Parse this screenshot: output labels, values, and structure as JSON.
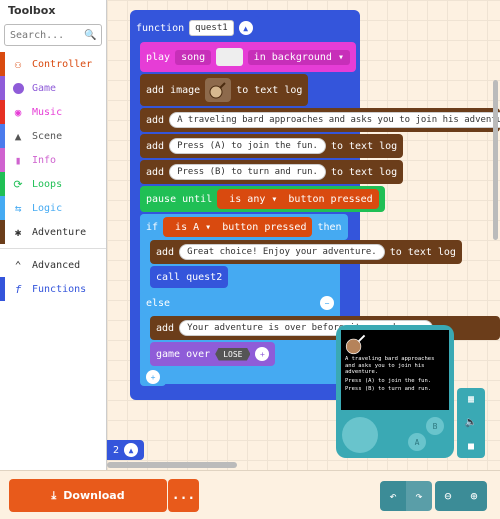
{
  "toolbox": {
    "title": "Toolbox",
    "search_placeholder": "Search...",
    "items": [
      {
        "label": "Controller",
        "color": "#d94a0f",
        "icon": "gamepad-icon"
      },
      {
        "label": "Game",
        "color": "#8f5cd8",
        "icon": "circle-icon"
      },
      {
        "label": "Music",
        "color": "#e63022",
        "icon": "headphones-icon"
      },
      {
        "label": "Scene",
        "color": "#4b7bec",
        "icon": "tree-icon"
      },
      {
        "label": "Info",
        "color": "#cf63cf",
        "icon": "card-icon"
      },
      {
        "label": "Loops",
        "color": "#20bf55",
        "icon": "loop-icon"
      },
      {
        "label": "Logic",
        "color": "#45aaf2",
        "icon": "shuffle-icon"
      },
      {
        "label": "Adventure",
        "color": "#6b3d1a",
        "icon": "compass-icon"
      },
      {
        "label": "Advanced",
        "color": "#333333",
        "icon": "chevron-up-icon"
      },
      {
        "label": "Functions",
        "color": "#3455db",
        "icon": "function-icon"
      }
    ]
  },
  "blocks": {
    "function_label": "function",
    "function_name": "quest1",
    "play": "play",
    "song": "song",
    "in_background": "in background",
    "add_image": "add image",
    "to_text_log": "to text log",
    "add": "add",
    "text1": "A traveling bard approaches and asks you to join his adventure.",
    "text2": "Press (A) to join the fun.",
    "text3": "Press (B) to turn and run.",
    "pause_until": "pause until",
    "is_any": "is any",
    "button_pressed": "button pressed",
    "if": "if",
    "is_A": "is A",
    "then": "then",
    "text4": "Great choice! Enjoy your adventure.",
    "call_quest2": "call quest2",
    "else": "else",
    "text5": "Your adventure is over before it even began.",
    "game_over": "game over",
    "lose": "LOSE",
    "side_num": "2"
  },
  "simulator": {
    "line1": "A traveling bard approaches and asks you to join his adventure.",
    "line2": "Press (A) to join the fun.",
    "line3": "Press (B) to turn and run.",
    "btn_a": "A",
    "btn_b": "B"
  },
  "bottom": {
    "download": "Download",
    "more": "..."
  },
  "colors": {
    "function": "#3455db",
    "music": "#e63dd6",
    "adventure": "#6b3d1a",
    "loops": "#20bf55",
    "logic": "#45aaf2",
    "controller": "#d94a0f",
    "game": "#8f5cd8"
  }
}
